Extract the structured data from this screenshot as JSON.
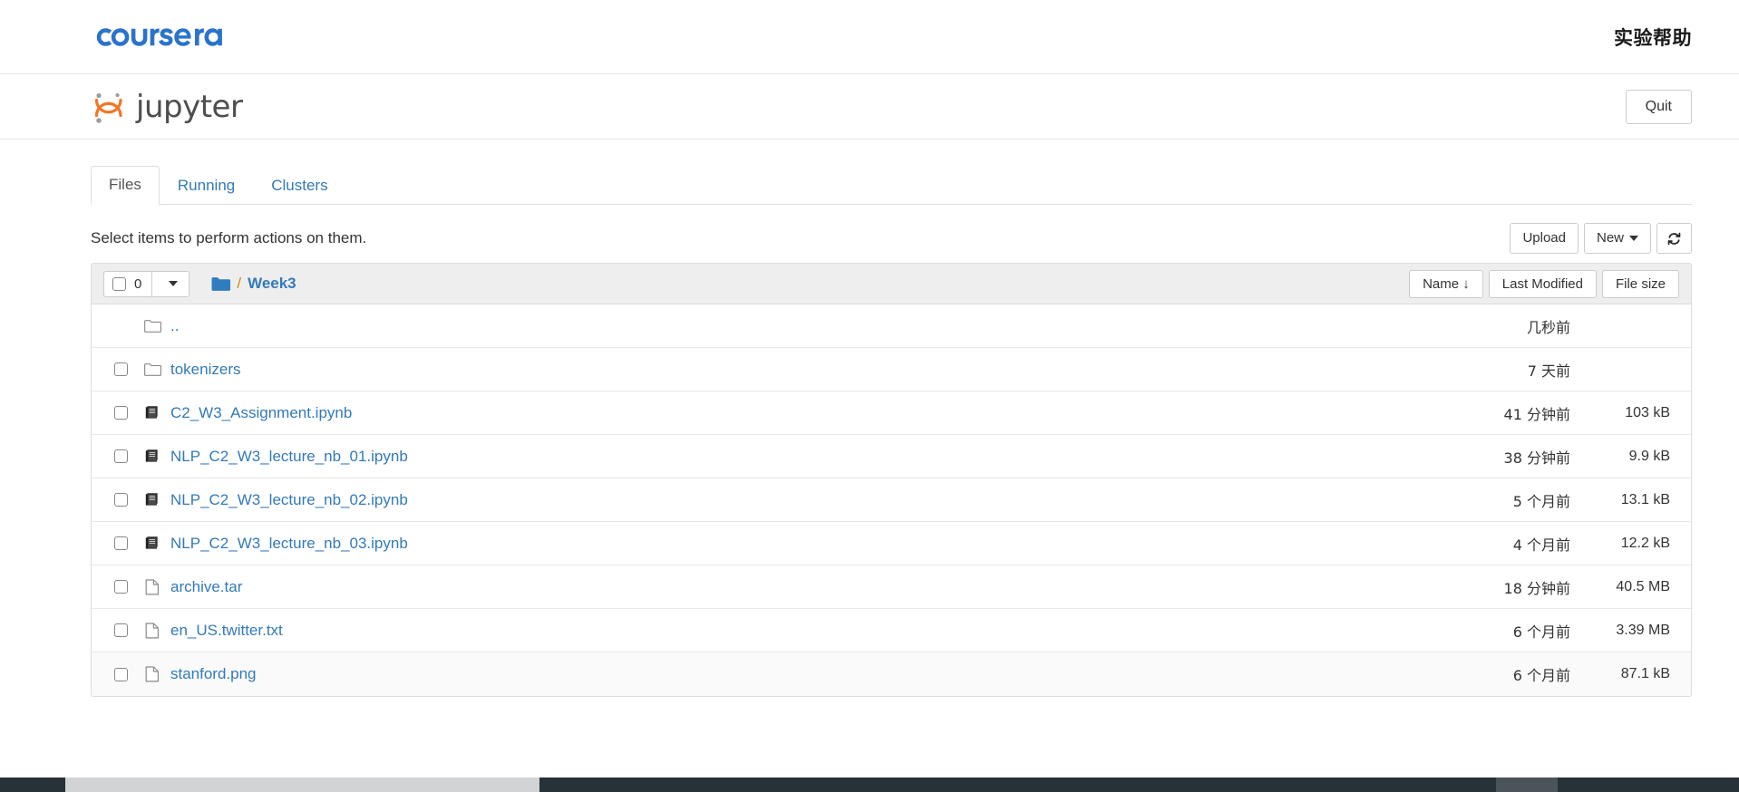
{
  "brand": {
    "coursera_name": "coursera",
    "lab_help": "实验帮助"
  },
  "jupyter": {
    "wordmark": "jupyter",
    "quit_label": "Quit"
  },
  "tabs": [
    {
      "label": "Files",
      "active": true
    },
    {
      "label": "Running",
      "active": false
    },
    {
      "label": "Clusters",
      "active": false
    }
  ],
  "toolbar": {
    "select_note": "Select items to perform actions on them.",
    "upload_label": "Upload",
    "new_label": "New",
    "refresh_label": "⟳"
  },
  "list_header": {
    "selected_count": "0",
    "breadcrumb_separator": "/",
    "breadcrumb_current": "Week3",
    "sort_name": "Name",
    "sort_name_arrow": "↓",
    "sort_modified": "Last Modified",
    "sort_size": "File size"
  },
  "files": [
    {
      "name": "..",
      "icon": "folder-icon",
      "type": "parent",
      "checkbox": false,
      "modified": "几秒前",
      "size": "",
      "hover": false
    },
    {
      "name": "tokenizers",
      "icon": "folder-icon",
      "type": "folder",
      "checkbox": true,
      "modified": "7 天前",
      "size": "",
      "hover": false
    },
    {
      "name": "C2_W3_Assignment.ipynb",
      "icon": "notebook-icon",
      "type": "notebook",
      "checkbox": true,
      "modified": "41 分钟前",
      "size": "103 kB",
      "hover": false
    },
    {
      "name": "NLP_C2_W3_lecture_nb_01.ipynb",
      "icon": "notebook-icon",
      "type": "notebook",
      "checkbox": true,
      "modified": "38 分钟前",
      "size": "9.9 kB",
      "hover": false
    },
    {
      "name": "NLP_C2_W3_lecture_nb_02.ipynb",
      "icon": "notebook-icon",
      "type": "notebook",
      "checkbox": true,
      "modified": "5 个月前",
      "size": "13.1 kB",
      "hover": false
    },
    {
      "name": "NLP_C2_W3_lecture_nb_03.ipynb",
      "icon": "notebook-icon",
      "type": "notebook",
      "checkbox": true,
      "modified": "4 个月前",
      "size": "12.2 kB",
      "hover": false
    },
    {
      "name": "archive.tar",
      "icon": "file-icon",
      "type": "file",
      "checkbox": true,
      "modified": "18 分钟前",
      "size": "40.5 MB",
      "hover": false
    },
    {
      "name": "en_US.twitter.txt",
      "icon": "file-icon",
      "type": "file",
      "checkbox": true,
      "modified": "6 个月前",
      "size": "3.39 MB",
      "hover": false
    },
    {
      "name": "stanford.png",
      "icon": "file-icon",
      "type": "file",
      "checkbox": true,
      "modified": "6 个月前",
      "size": "87.1 kB",
      "hover": true
    }
  ],
  "colors": {
    "coursera_blue": "#2a73cc",
    "link_blue": "#337ab7",
    "jupyter_orange": "#f37626",
    "header_gray": "#eeeeee",
    "taskbar_dark": "#263238"
  }
}
